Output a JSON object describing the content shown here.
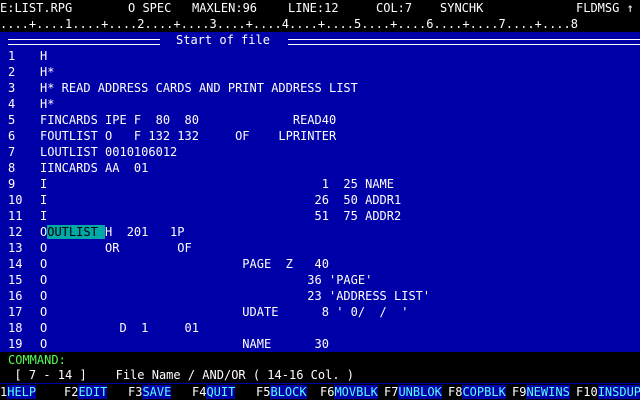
{
  "status": {
    "file": "E:LIST.RPG",
    "spec": "O SPEC",
    "maxlen": "MAXLEN:96",
    "line": "LINE:12",
    "col": "COL:7",
    "synchk": "SYNCHK",
    "fldmsg": "FLDMSG ↑"
  },
  "ruler": "....+....1....+....2....+....3....+....4....+....5....+....6....+....7....+....8",
  "start_label": "Start of file",
  "lines": [
    {
      "n": "1",
      "pre": "H",
      "hl": "",
      "post": ""
    },
    {
      "n": "2",
      "pre": "H*",
      "hl": "",
      "post": ""
    },
    {
      "n": "3",
      "pre": "H* READ ADDRESS CARDS AND PRINT ADDRESS LIST",
      "hl": "",
      "post": ""
    },
    {
      "n": "4",
      "pre": "H*",
      "hl": "",
      "post": ""
    },
    {
      "n": "5",
      "pre": "FINCARDS IPE F  80  80             READ40",
      "hl": "",
      "post": ""
    },
    {
      "n": "6",
      "pre": "FOUTLIST O   F 132 132     OF    LPRINTER",
      "hl": "",
      "post": ""
    },
    {
      "n": "7",
      "pre": "LOUTLIST 0010106012",
      "hl": "",
      "post": ""
    },
    {
      "n": "8",
      "pre": "IINCARDS AA  01",
      "hl": "",
      "post": ""
    },
    {
      "n": "9",
      "pre": "I                                      1  25 NAME",
      "hl": "",
      "post": ""
    },
    {
      "n": "10",
      "pre": "I                                     26  50 ADDR1",
      "hl": "",
      "post": ""
    },
    {
      "n": "11",
      "pre": "I                                     51  75 ADDR2",
      "hl": "",
      "post": ""
    },
    {
      "n": "12",
      "pre": "O",
      "hl": "OUTLIST ",
      "post": "H  201   1P"
    },
    {
      "n": "13",
      "pre": "O        OR        OF",
      "hl": "",
      "post": ""
    },
    {
      "n": "14",
      "pre": "O                           PAGE  Z   40",
      "hl": "",
      "post": ""
    },
    {
      "n": "15",
      "pre": "O                                    36 'PAGE'",
      "hl": "",
      "post": ""
    },
    {
      "n": "16",
      "pre": "O                                    23 'ADDRESS LIST'",
      "hl": "",
      "post": ""
    },
    {
      "n": "17",
      "pre": "O                           UDATE      8 ' 0/  /  '",
      "hl": "",
      "post": ""
    },
    {
      "n": "18",
      "pre": "O          D  1     01",
      "hl": "",
      "post": ""
    },
    {
      "n": "19",
      "pre": "O                           NAME      30",
      "hl": "",
      "post": ""
    }
  ],
  "command_label": "COMMAND:",
  "hint": "  [ 7 - 14 ]    File Name / AND/OR ( 14-16 Col. )",
  "fkeys": [
    {
      "num": "1",
      "label": "HELP"
    },
    {
      "num": "F2",
      "label": "EDIT"
    },
    {
      "num": "F3",
      "label": "SAVE"
    },
    {
      "num": "F4",
      "label": "QUIT"
    },
    {
      "num": "F5",
      "label": "BLOCK"
    },
    {
      "num": "F6",
      "label": "MOVBLK"
    },
    {
      "num": "F7",
      "label": "UNBLOK"
    },
    {
      "num": "F8",
      "label": "COPBLK"
    },
    {
      "num": "F9",
      "label": "NEWINS"
    },
    {
      "num": "F10",
      "label": "INSDUP"
    }
  ]
}
